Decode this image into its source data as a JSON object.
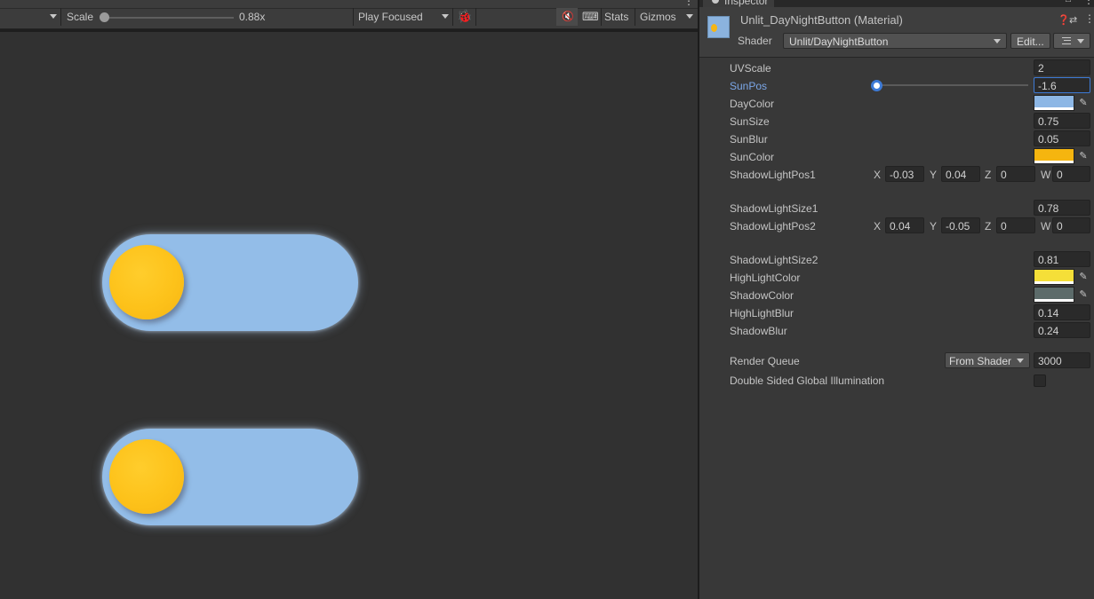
{
  "game_toolbar": {
    "scale_label": "Scale",
    "scale_value": "0.88x",
    "scale_fraction": 0.0,
    "play_mode": "Play Focused",
    "stats_label": "Stats",
    "gizmos_label": "Gizmos"
  },
  "game_view": {
    "toggles": [
      {
        "name": "toggle-1",
        "sun_color": "#fdc21a",
        "track_color": "#93bde8"
      },
      {
        "name": "toggle-2",
        "sun_color": "#fdc21a",
        "track_color": "#93bde8"
      }
    ]
  },
  "inspector": {
    "tab_label": "Inspector",
    "material_title": "Unlit_DayNightButton (Material)",
    "shader_label": "Shader",
    "shader_value": "Unlit/DayNightButton",
    "edit_label": "Edit...",
    "properties": {
      "uvscale": {
        "label": "UVScale",
        "value": "2"
      },
      "sunpos": {
        "label": "SunPos",
        "value": "-1.6",
        "slider_fraction": 0.0
      },
      "daycolor": {
        "label": "DayColor",
        "color": "#8db7e5"
      },
      "sunsize": {
        "label": "SunSize",
        "value": "0.75"
      },
      "sunblur": {
        "label": "SunBlur",
        "value": "0.05"
      },
      "suncolor": {
        "label": "SunColor",
        "color": "#f5b50f"
      },
      "shadowlightpos1": {
        "label": "ShadowLightPos1",
        "x": "-0.03",
        "y": "0.04",
        "z": "0",
        "w": "0"
      },
      "shadowlightsize1": {
        "label": "ShadowLightSize1",
        "value": "0.78"
      },
      "shadowlightpos2": {
        "label": "ShadowLightPos2",
        "x": "0.04",
        "y": "-0.05",
        "z": "0",
        "w": "0"
      },
      "shadowlightsize2": {
        "label": "ShadowLightSize2",
        "value": "0.81"
      },
      "highlightcolor": {
        "label": "HighLightColor",
        "color": "#f5df38"
      },
      "shadowcolor": {
        "label": "ShadowColor",
        "color": "#5c6b6a"
      },
      "highlightblur": {
        "label": "HighLightBlur",
        "value": "0.14"
      },
      "shadowblur": {
        "label": "ShadowBlur",
        "value": "0.24"
      }
    },
    "vector_letters": {
      "x": "X",
      "y": "Y",
      "z": "Z",
      "w": "W"
    },
    "render_queue": {
      "label": "Render Queue",
      "mode": "From Shader",
      "value": "3000"
    },
    "double_sided_gi": {
      "label": "Double Sided Global Illumination",
      "checked": false
    }
  }
}
